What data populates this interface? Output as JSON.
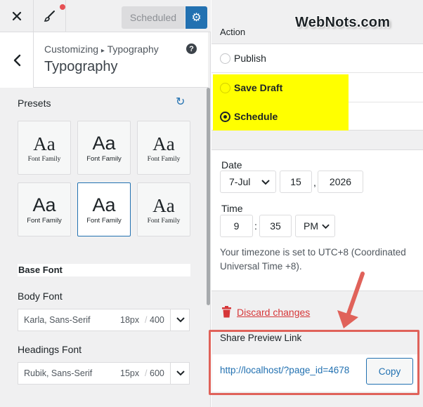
{
  "topbar": {
    "close_icon": "close-icon",
    "brush_icon": "paintbrush-icon",
    "publish_button_label": "Scheduled",
    "settings_icon": "gear-icon",
    "settings_symbol": "⚙"
  },
  "section": {
    "breadcrumb_root": "Customizing",
    "breadcrumb_sep": "▸",
    "breadcrumb_current": "Typography",
    "title": "Typography",
    "help_symbol": "?",
    "back_symbol": "‹"
  },
  "presets": {
    "label": "Presets",
    "reset_symbol": "↻",
    "cards": [
      {
        "sample": "Aa",
        "caption": "Font Family",
        "style": "serif"
      },
      {
        "sample": "Aa",
        "caption": "Font Family",
        "style": "sans"
      },
      {
        "sample": "Aa",
        "caption": "Font Family",
        "style": "serif"
      },
      {
        "sample": "Aa",
        "caption": "Font Family",
        "style": "sans"
      },
      {
        "sample": "Aa",
        "caption": "Font Family",
        "style": "sans",
        "selected": true
      },
      {
        "sample": "Aa",
        "caption": "Font Family",
        "style": "serif"
      }
    ]
  },
  "base_font": {
    "heading": "Base Font",
    "body": {
      "label": "Body Font",
      "family": "Karla, Sans-Serif",
      "size": "18px",
      "separator": "/",
      "weight": "400"
    },
    "headings": {
      "label": "Headings Font",
      "family": "Rubik, Sans-Serif",
      "size": "15px",
      "separator": "/",
      "weight": "600"
    }
  },
  "publish_settings": {
    "action_label": "Action",
    "options": [
      {
        "label": "Publish",
        "checked": false
      },
      {
        "label": "Save Draft",
        "checked": false
      },
      {
        "label": "Schedule",
        "checked": true
      }
    ],
    "date_label": "Date",
    "date": {
      "month": "7-Jul",
      "day": "15",
      "comma": ",",
      "year": "2026"
    },
    "time_label": "Time",
    "time": {
      "hour": "9",
      "colon": ":",
      "minute": "35",
      "meridiem": "PM"
    },
    "timezone_text": "Your timezone is set to UTC+8 (Coordinated Universal Time +8).",
    "discard_label": "Discard changes",
    "share_label": "Share Preview Link",
    "share_url": "http://localhost/?page_id=4678",
    "copy_label": "Copy"
  },
  "watermark": "WebNots.com",
  "colors": {
    "accent": "#2271b1",
    "highlight": "#ffff00",
    "annotation": "#e0625a",
    "danger": "#d63638"
  }
}
